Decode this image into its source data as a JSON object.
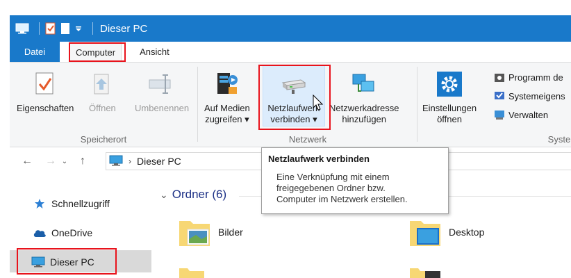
{
  "window": {
    "title": "Dieser PC"
  },
  "tabs": {
    "file": "Datei",
    "computer": "Computer",
    "view": "Ansicht"
  },
  "ribbon": {
    "location_group": {
      "label": "Speicherort",
      "properties": "Eigenschaften",
      "open": "Öffnen",
      "rename": "Umbenennen"
    },
    "network_group": {
      "label": "Netzwerk",
      "media_line1": "Auf Medien",
      "media_line2": "zugreifen",
      "map_drive_line1": "Netzlaufwerk",
      "map_drive_line2": "verbinden",
      "add_location_line1": "Netzwerkadresse",
      "add_location_line2": "hinzufügen"
    },
    "system_group": {
      "label": "System",
      "settings_line1": "Einstellungen",
      "settings_line2": "öffnen",
      "programs": "Programm de",
      "system_props": "Systemeigens",
      "manage": "Verwalten"
    }
  },
  "address": {
    "current": "Dieser PC"
  },
  "nav_pane": {
    "quick_access": "Schnellzugriff",
    "onedrive": "OneDrive",
    "this_pc": "Dieser PC"
  },
  "content": {
    "section_title": "Ordner (6)",
    "folders": [
      "Bilder",
      "Desktop"
    ]
  },
  "tooltip": {
    "title": "Netzlaufwerk verbinden",
    "body_line1": "Eine Verknüpfung mit einem",
    "body_line2": "freigegebenen Ordner bzw.",
    "body_line3": "Computer im Netzwerk erstellen."
  },
  "colors": {
    "accent": "#1979ca",
    "highlight": "#e8131c",
    "ribbon_bg": "#f5f6f7"
  }
}
